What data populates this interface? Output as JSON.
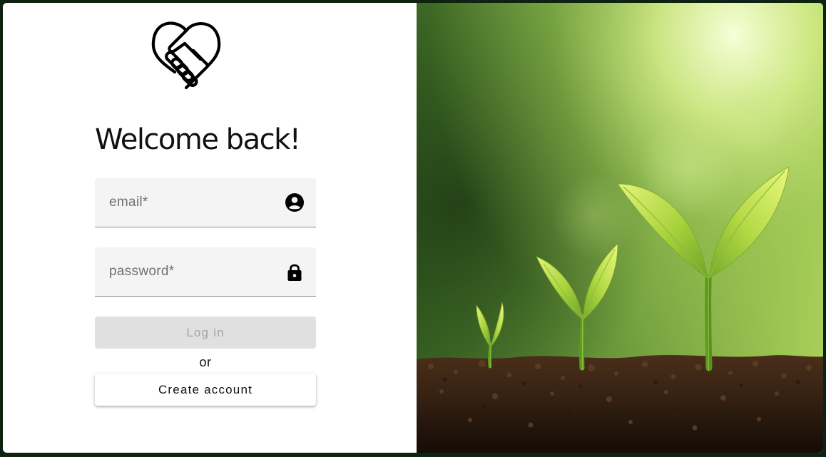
{
  "login": {
    "title": "Welcome back!",
    "email": {
      "placeholder": "email*",
      "value": ""
    },
    "password": {
      "placeholder": "password*",
      "value": ""
    },
    "login_button": "Log in",
    "separator": "or",
    "create_account_button": "Create account"
  },
  "icons": {
    "logo": "heart-handshake-icon",
    "email": "account-circle-icon",
    "password": "lock-icon"
  },
  "colors": {
    "page_background": "#0d2210",
    "field_background": "#f4f4f4",
    "disabled_button": "#e0e0e0",
    "disabled_text": "#a5a5a5"
  },
  "hero": {
    "image": "sprouting-seedlings-in-soil"
  }
}
